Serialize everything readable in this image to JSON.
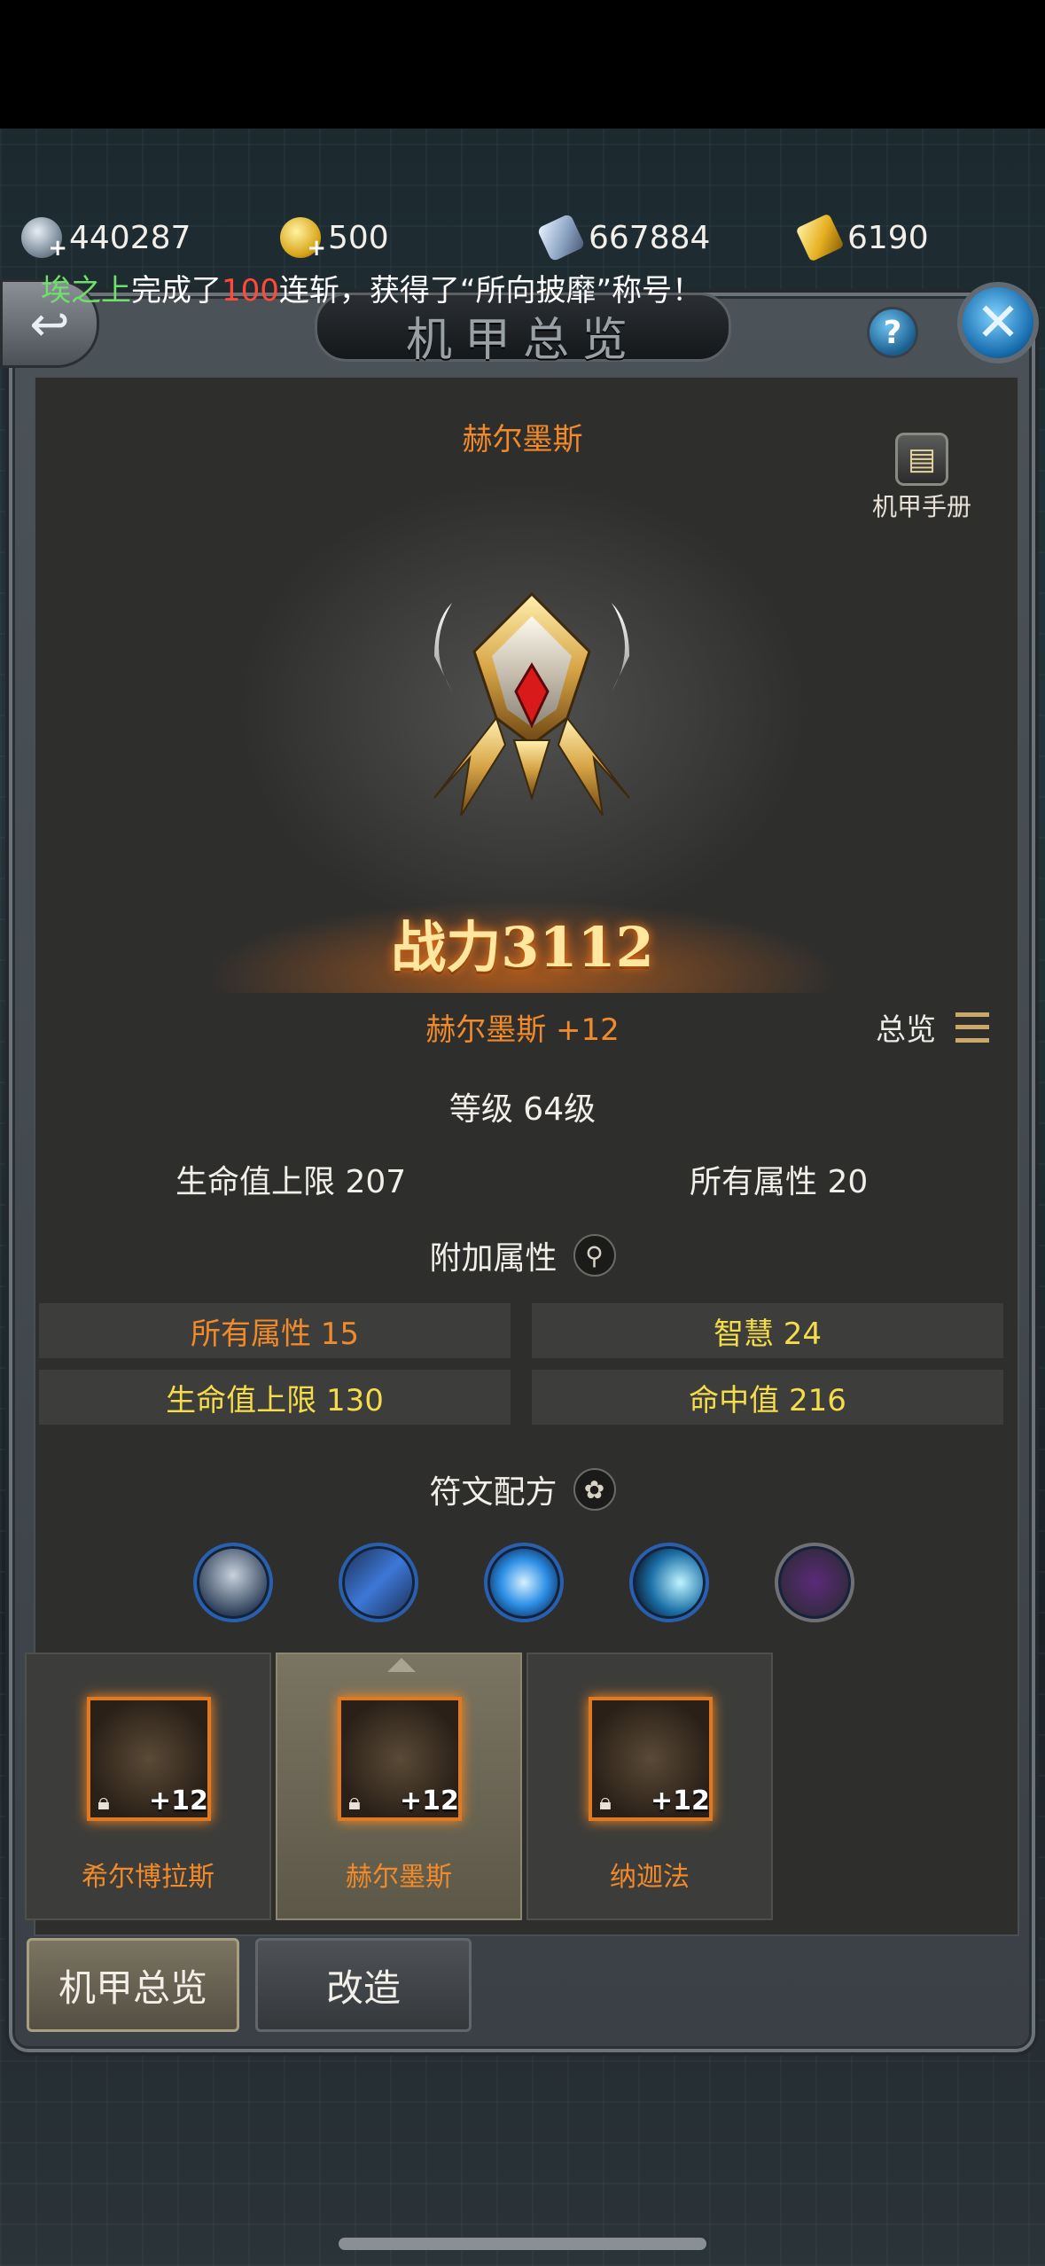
{
  "resources": [
    {
      "icon": "silver-coin-icon",
      "value": "440287"
    },
    {
      "icon": "gold-coin-icon",
      "value": "500"
    },
    {
      "icon": "crystal-icon",
      "value": "667884"
    },
    {
      "icon": "gold-bar-icon",
      "value": "6190"
    }
  ],
  "marquee": {
    "player": "埃之上",
    "pre": "完成了",
    "count": "100",
    "post": "连斩，获得了“所向披靡”称号！"
  },
  "window": {
    "title": "机甲总览",
    "help": "?",
    "close": "✕"
  },
  "mecha": {
    "name": "赫尔墨斯",
    "manual_label": "机甲手册",
    "power": "战力3112",
    "name_level": "赫尔墨斯 +12",
    "overview_label": "总览",
    "grade": "等级 64级",
    "base_stats": [
      "生命值上限 207",
      "所有属性 20"
    ]
  },
  "extra_attributes": {
    "heading": "附加属性",
    "items": [
      {
        "text": "所有属性 15",
        "color": "#f08a2a"
      },
      {
        "text": "智慧 24",
        "color": "#f4dc4a"
      },
      {
        "text": "生命值上限 130",
        "color": "#f4dc4a"
      },
      {
        "text": "命中值 216",
        "color": "#f4dc4a"
      }
    ]
  },
  "runes": {
    "heading": "符文配方",
    "items": [
      "rune-spike-icon",
      "rune-staff-icon",
      "rune-orb-icon",
      "rune-cannon-icon",
      "rune-gem-icon"
    ]
  },
  "cards": [
    {
      "name": "希尔博拉斯",
      "level": "+12",
      "selected": false
    },
    {
      "name": "赫尔墨斯",
      "level": "+12",
      "selected": true
    },
    {
      "name": "纳迦法",
      "level": "+12",
      "selected": false
    }
  ],
  "tabs": [
    {
      "label": "机甲总览",
      "active": true
    },
    {
      "label": "改造",
      "active": false
    }
  ],
  "colors": {
    "accent_orange": "#f08a2a",
    "accent_yellow": "#f4dc4a",
    "panel_bg": "#2e2e2d"
  }
}
